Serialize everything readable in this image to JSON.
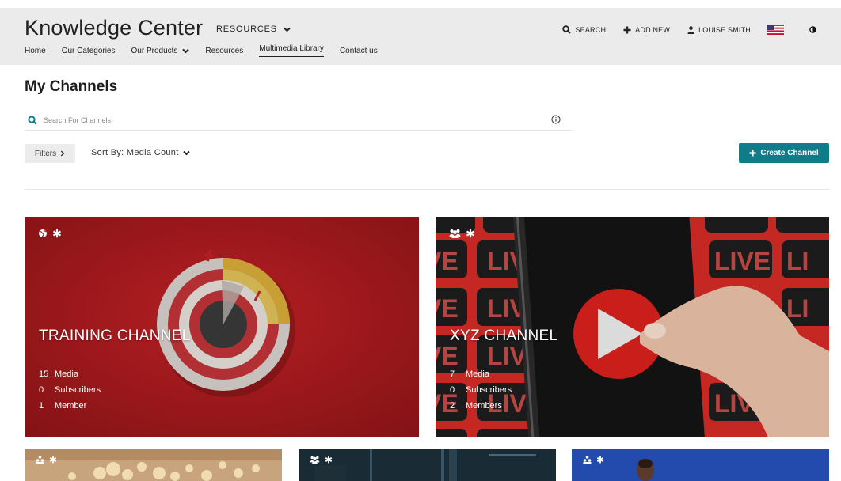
{
  "header": {
    "site_title": "Knowledge Center",
    "resources_dropdown": "RESOURCES",
    "nav": [
      "Home",
      "Our Categories",
      "Our Products",
      "Resources",
      "Multimedia Library",
      "Contact us"
    ],
    "active_nav": "Multimedia Library",
    "search_label": "SEARCH",
    "add_new_label": "ADD NEW",
    "user_name": "LOUISE SMITH",
    "language_flag": "us-flag-icon",
    "contrast_icon": "contrast-icon"
  },
  "page": {
    "title": "My Channels",
    "search_placeholder": "Search For Channels",
    "filters_label": "Filters",
    "sort_label": "Sort By: Media Count",
    "create_button": "Create Channel"
  },
  "channels": [
    {
      "title": "TRAINING CHANNEL",
      "media_count": "15",
      "media_label": "Media",
      "subscribers_count": "0",
      "subscribers_label": "Subscribers",
      "members_count": "1",
      "members_label": "Member",
      "icons": [
        "globe-icon",
        "asterisk-icon"
      ],
      "color": "#b21c20"
    },
    {
      "title": "XYZ CHANNEL",
      "media_count": "7",
      "media_label": "Media",
      "subscribers_count": "0",
      "subscribers_label": "Subscribers",
      "members_count": "2",
      "members_label": "Members",
      "icons": [
        "group-icon",
        "asterisk-icon"
      ],
      "color": "#cc1f1f"
    },
    {
      "icons": [
        "users-icon",
        "asterisk-icon"
      ]
    },
    {
      "icons": [
        "group-icon",
        "asterisk-icon"
      ]
    },
    {
      "icons": [
        "users-icon",
        "asterisk-icon"
      ]
    }
  ],
  "colors": {
    "accent": "#0e7c89",
    "header_bg": "#ebebeb"
  }
}
